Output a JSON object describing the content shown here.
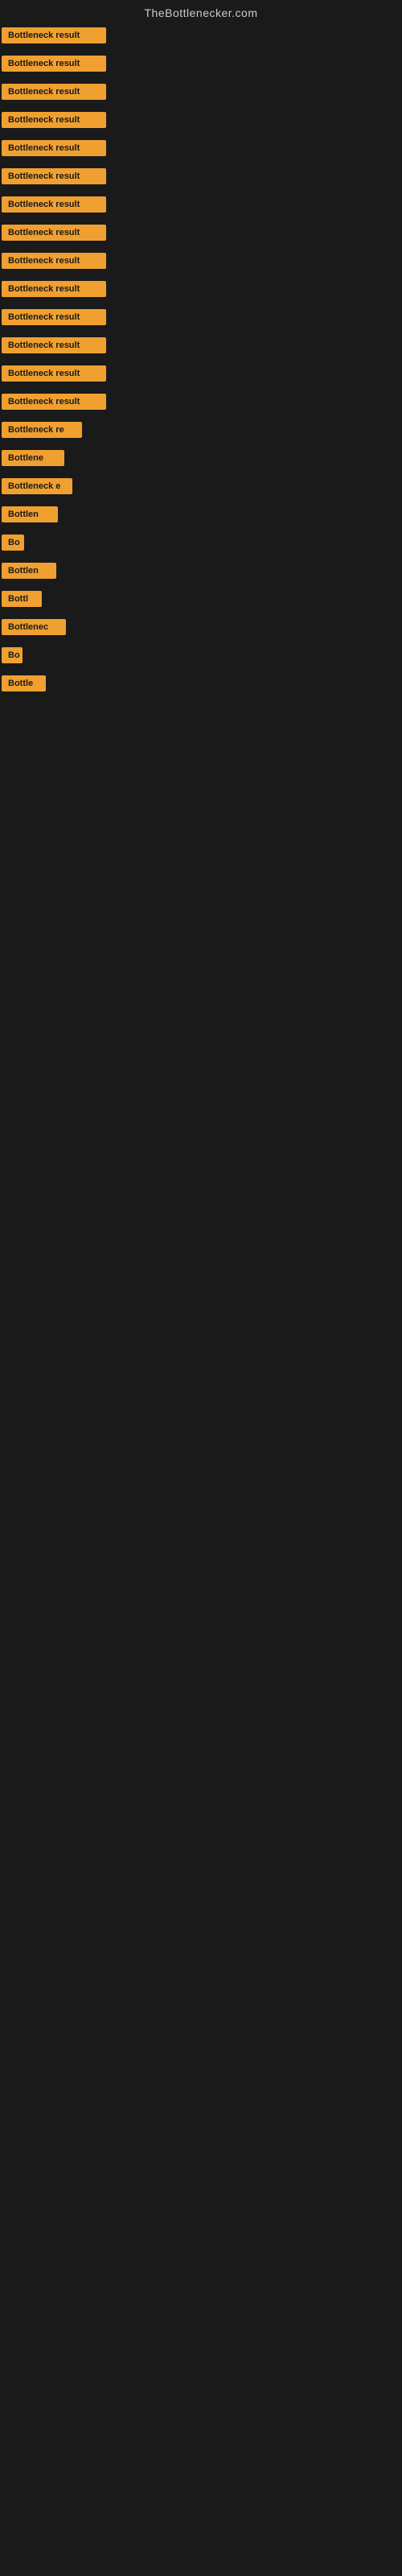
{
  "header": {
    "title": "TheBottlenecker.com"
  },
  "items": [
    {
      "label": "Bottleneck result",
      "width": 130
    },
    {
      "label": "Bottleneck result",
      "width": 130
    },
    {
      "label": "Bottleneck result",
      "width": 130
    },
    {
      "label": "Bottleneck result",
      "width": 130
    },
    {
      "label": "Bottleneck result",
      "width": 130
    },
    {
      "label": "Bottleneck result",
      "width": 130
    },
    {
      "label": "Bottleneck result",
      "width": 130
    },
    {
      "label": "Bottleneck result",
      "width": 130
    },
    {
      "label": "Bottleneck result",
      "width": 130
    },
    {
      "label": "Bottleneck result",
      "width": 130
    },
    {
      "label": "Bottleneck result",
      "width": 130
    },
    {
      "label": "Bottleneck result",
      "width": 130
    },
    {
      "label": "Bottleneck result",
      "width": 130
    },
    {
      "label": "Bottleneck result",
      "width": 130
    },
    {
      "label": "Bottleneck re",
      "width": 100
    },
    {
      "label": "Bottlene",
      "width": 78
    },
    {
      "label": "Bottleneck e",
      "width": 88
    },
    {
      "label": "Bottlen",
      "width": 70
    },
    {
      "label": "Bo",
      "width": 28
    },
    {
      "label": "Bottlen",
      "width": 68
    },
    {
      "label": "Bottl",
      "width": 50
    },
    {
      "label": "Bottlenec",
      "width": 80
    },
    {
      "label": "Bo",
      "width": 26
    },
    {
      "label": "Bottle",
      "width": 55
    }
  ],
  "colors": {
    "badge_bg": "#f0a030",
    "badge_text": "#1a1a1a",
    "body_bg": "#1a1a1a",
    "header_text": "#cccccc"
  }
}
